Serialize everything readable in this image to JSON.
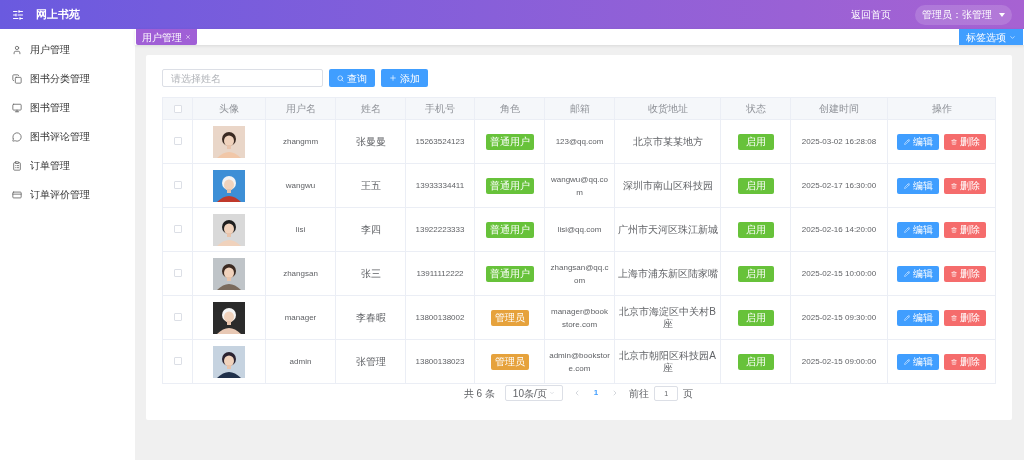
{
  "header": {
    "title": "网上书苑",
    "home_link": "返回首页",
    "user_menu": "管理员：张管理"
  },
  "sidebar": {
    "items": [
      {
        "label": "用户管理"
      },
      {
        "label": "图书分类管理"
      },
      {
        "label": "图书管理"
      },
      {
        "label": "图书评论管理"
      },
      {
        "label": "订单管理"
      },
      {
        "label": "订单评价管理"
      }
    ]
  },
  "tabs": [
    {
      "label": "用户管理",
      "selected": true
    }
  ],
  "tab_options": "标签选项",
  "search": {
    "placeholder": "请选择姓名",
    "search_button": "查询",
    "add_button": "添加"
  },
  "table": {
    "header_checked": false,
    "columns": [
      "头像",
      "用户名",
      "姓名",
      "手机号",
      "角色",
      "邮箱",
      "收货地址",
      "状态",
      "创建时间",
      "操作"
    ],
    "rows": [
      {
        "checked": false,
        "username": "zhangmm",
        "name": "张曼曼",
        "phone": "15263524123",
        "role": {
          "label": "普通用户",
          "kind": "user"
        },
        "email": "123@qq.com",
        "address": "北京市某某地方",
        "status": "启用",
        "created": "2025-03-02 16:28:08",
        "actions": [
          "编辑",
          "删除"
        ]
      },
      {
        "checked": false,
        "username": "wangwu",
        "name": "王五",
        "phone": "13933334411",
        "role": {
          "label": "普通用户",
          "kind": "user"
        },
        "email": "wangwu@qq.com",
        "address": "深圳市南山区科技园",
        "status": "启用",
        "created": "2025-02-17 16:30:00",
        "actions": [
          "编辑",
          "删除"
        ]
      },
      {
        "checked": false,
        "username": "lisi",
        "name": "李四",
        "phone": "13922223333",
        "role": {
          "label": "普通用户",
          "kind": "user"
        },
        "email": "lisi@qq.com",
        "address": "广州市天河区珠江新城",
        "status": "启用",
        "created": "2025-02-16 14:20:00",
        "actions": [
          "编辑",
          "删除"
        ]
      },
      {
        "checked": false,
        "username": "zhangsan",
        "name": "张三",
        "phone": "13911112222",
        "role": {
          "label": "普通用户",
          "kind": "user"
        },
        "email": "zhangsan@qq.com",
        "address": "上海市浦东新区陆家嘴",
        "status": "启用",
        "created": "2025-02-15 10:00:00",
        "actions": [
          "编辑",
          "删除"
        ]
      },
      {
        "checked": false,
        "username": "manager",
        "name": "李春暇",
        "phone": "13800138002",
        "role": {
          "label": "管理员",
          "kind": "admin"
        },
        "email": "manager@bookstore.com",
        "address": "北京市海淀区中关村B座",
        "status": "启用",
        "created": "2025-02-15 09:30:00",
        "actions": [
          "编辑",
          "删除"
        ]
      },
      {
        "checked": false,
        "username": "admin",
        "name": "张管理",
        "phone": "13800138023",
        "role": {
          "label": "管理员",
          "kind": "admin"
        },
        "email": "admin@bookstore.com",
        "address": "北京市朝阳区科技园A座",
        "status": "启用",
        "created": "2025-02-15 09:00:00",
        "actions": [
          "编辑",
          "删除"
        ]
      }
    ]
  },
  "pagination": {
    "total": "共 6 条",
    "page_size": "10条/页",
    "pages": [
      {
        "label": "1",
        "selected": true
      }
    ],
    "goto_label": "前往",
    "goto_value": "1",
    "goto_suffix": "页"
  }
}
